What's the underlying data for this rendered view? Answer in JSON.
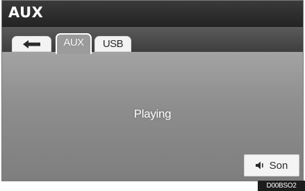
{
  "header": {
    "title": "AUX"
  },
  "tabs": [
    {
      "label": "",
      "icon": "back-arrow-icon"
    },
    {
      "label": "AUX",
      "selected": true
    },
    {
      "label": "USB"
    }
  ],
  "main": {
    "status": "Playing"
  },
  "sound_button": {
    "label": "Son",
    "icon": "speaker-icon"
  },
  "figure_code": "D00BSO2"
}
